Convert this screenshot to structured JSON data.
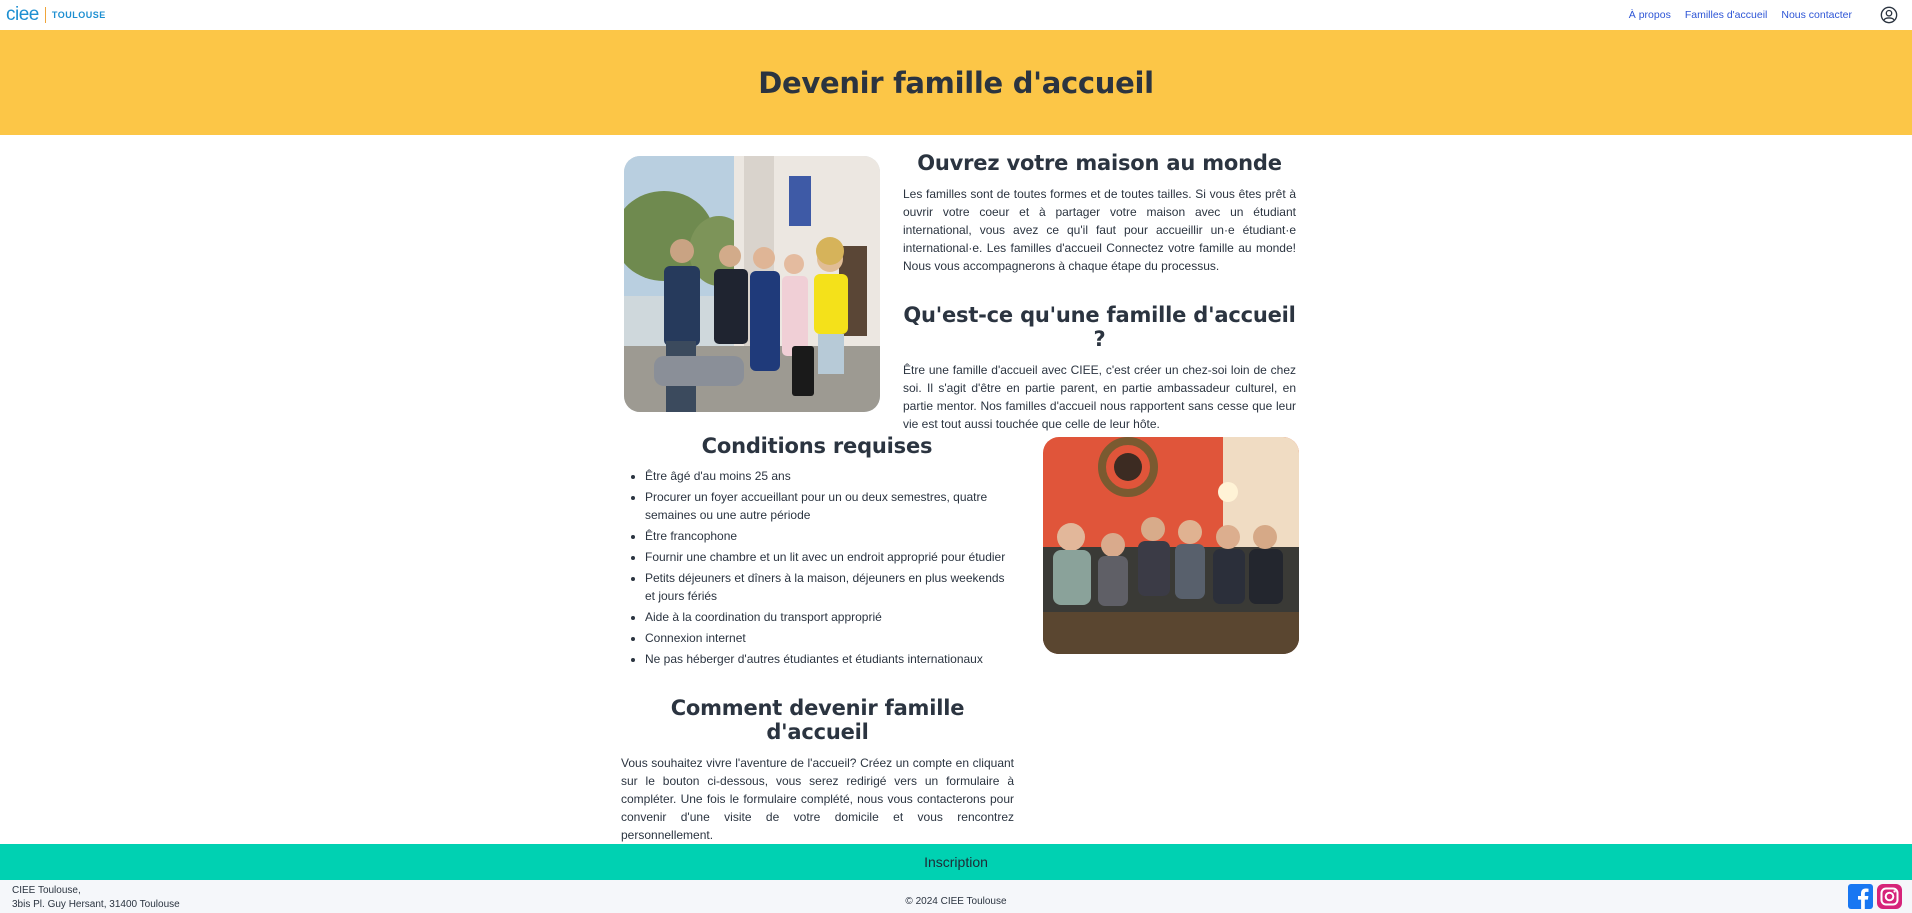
{
  "nav": {
    "logo": "ciee",
    "city": "TOULOUSE",
    "links": [
      "À propos",
      "Familles d'accueil",
      "Nous contacter"
    ],
    "user_icon": "user-circle-icon"
  },
  "banner": {
    "title": "Devenir famille d'accueil"
  },
  "intro": {
    "title": "Ouvrez votre maison au monde",
    "text": "Les familles sont de toutes formes et de toutes tailles. Si vous êtes prêt à ouvrir votre coeur et à partager votre maison avec un étudiant international, vous avez ce qu'il faut pour accueillir un·e étudiant·e international·e. Les familles d'accueil Connectez votre famille au monde! Nous vous accompagnerons à chaque étape du processus."
  },
  "what": {
    "title": "Qu'est-ce qu'une famille d'accueil ?",
    "text": "Être une famille d'accueil avec CIEE, c'est créer un chez-soi loin de chez soi. Il s'agit d'être en partie parent, en partie ambassadeur culturel, en partie mentor. Nos familles d'accueil nous rapportent sans cesse que leur vie est tout aussi touchée que celle de leur hôte."
  },
  "requirements": {
    "title": "Conditions requises",
    "items": [
      "Être âgé d'au moins 25 ans",
      "Procurer un foyer accueillant pour un ou deux semestres, quatre semaines ou une autre période",
      "Être francophone",
      "Fournir une chambre et un lit avec un endroit approprié pour étudier",
      "Petits déjeuners et dîners à la maison, déjeuners en plus weekends et jours fériés",
      "Aide à la coordination du transport approprié",
      "Connexion internet",
      "Ne pas héberger d'autres étudiantes et étudiants internationaux"
    ]
  },
  "how": {
    "title": "Comment devenir famille d'accueil",
    "text": "Vous souhaitez vivre l'aventure de l'accueil? Créez un compte en cliquant sur le bouton ci-dessous, vous serez redirigé vers un formulaire à compléter. Une fois le formulaire complété, nous vous contacterons pour convenir d'une visite de votre domicile et vous rencontrez personnellement."
  },
  "cta": {
    "label": "Inscription"
  },
  "footer": {
    "address_line1": "CIEE Toulouse,",
    "address_line2": "3bis Pl. Guy Hersant, 31400 Toulouse",
    "copyright": "© 2024 CIEE Toulouse",
    "social": [
      "facebook-icon",
      "instagram-icon"
    ]
  },
  "colors": {
    "banner": "#fcc647",
    "cta": "#00d1b2",
    "link": "#2d55d6",
    "brand": "#1d8fd1"
  }
}
